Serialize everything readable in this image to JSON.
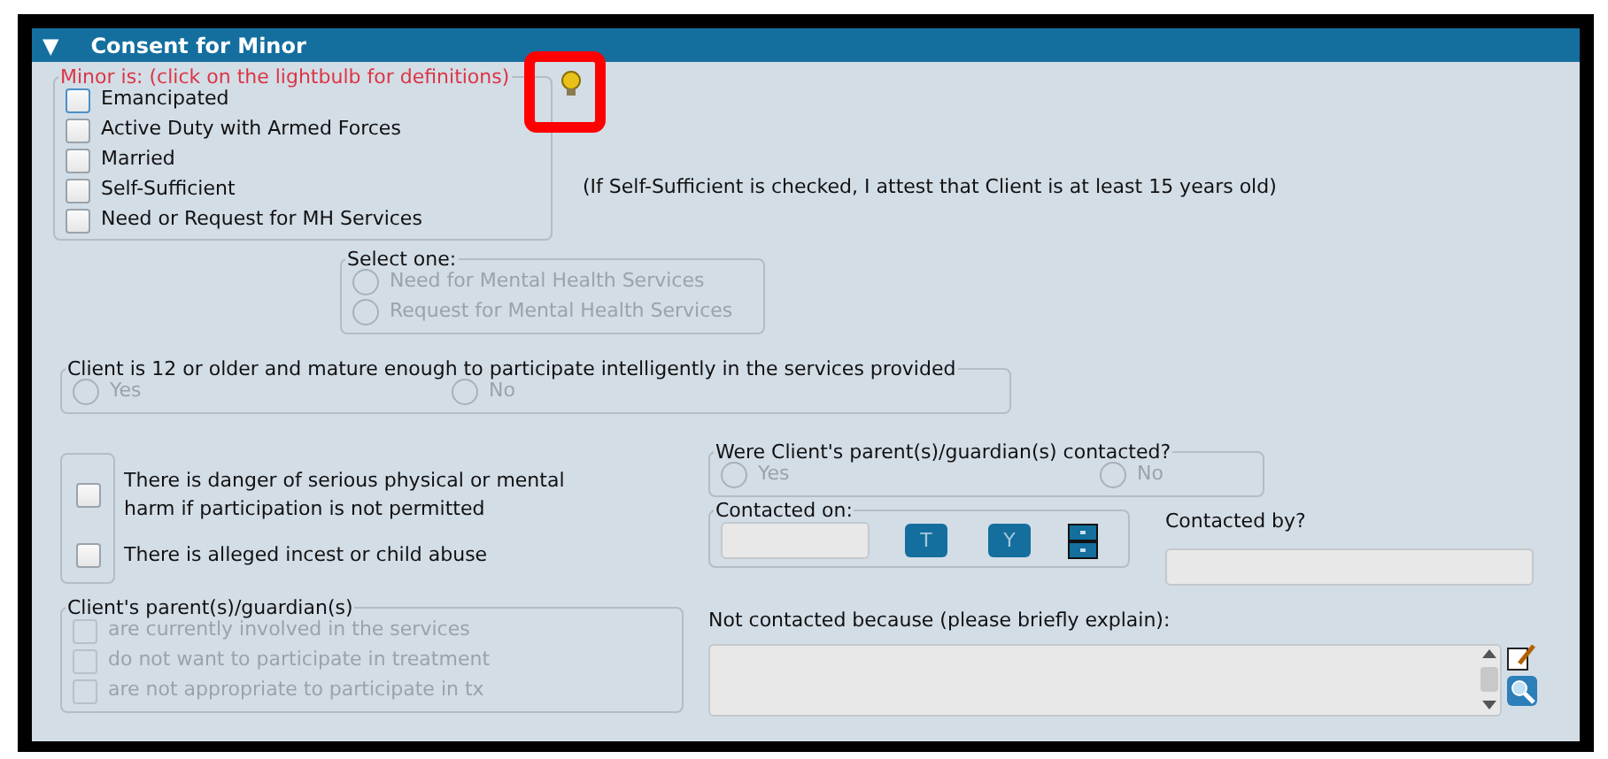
{
  "section": {
    "toggle": "▼",
    "title": "Consent for Minor",
    "expanded": true
  },
  "minor": {
    "legend": "Minor is: (click on the lightbulb for definitions)",
    "lightbulb_highlighted": true,
    "options": [
      {
        "label": "Emancipated",
        "checked": false,
        "focused": true
      },
      {
        "label": "Active Duty with Armed Forces",
        "checked": false,
        "focused": false
      },
      {
        "label": "Married",
        "checked": false,
        "focused": false
      },
      {
        "label": "Self-Sufficient",
        "checked": false,
        "focused": false
      },
      {
        "label": "Need or Request for MH Services",
        "checked": false,
        "focused": false
      }
    ],
    "note": "(If Self-Sufficient is checked, I attest that Client is at least 15 years old)"
  },
  "select_one": {
    "legend": "Select one:",
    "disabled": true,
    "options": [
      {
        "label": "Need for Mental Health Services",
        "selected": false
      },
      {
        "label": "Request for Mental Health Services",
        "selected": false
      }
    ]
  },
  "mature": {
    "legend": "Client is 12 or older and mature enough to participate intelligently in the services provided",
    "disabled": true,
    "options": [
      {
        "label": "Yes",
        "selected": false
      },
      {
        "label": "No",
        "selected": false
      }
    ]
  },
  "risks": [
    {
      "label": "There is danger of serious physical or mental harm if participation is not permitted",
      "checked": false
    },
    {
      "label": "There is alleged incest or child abuse",
      "checked": false
    }
  ],
  "guardians": {
    "legend": "Client's parent(s)/guardian(s)",
    "disabled": true,
    "options": [
      {
        "label": "are currently involved in the services",
        "checked": false
      },
      {
        "label": "do not want to participate in treatment",
        "checked": false
      },
      {
        "label": "are not appropriate to participate in tx",
        "checked": false
      }
    ]
  },
  "contacted": {
    "legend": "Were Client's parent(s)/guardian(s) contacted?",
    "disabled": true,
    "options": [
      {
        "label": "Yes",
        "selected": false
      },
      {
        "label": "No",
        "selected": false
      }
    ]
  },
  "contacted_on": {
    "legend": "Contacted on:",
    "buttons": [
      "T",
      "Y"
    ]
  },
  "contacted_by": {
    "label": "Contacted by?"
  },
  "not_contacted": {
    "label": "Not contacted because (please briefly explain):"
  }
}
